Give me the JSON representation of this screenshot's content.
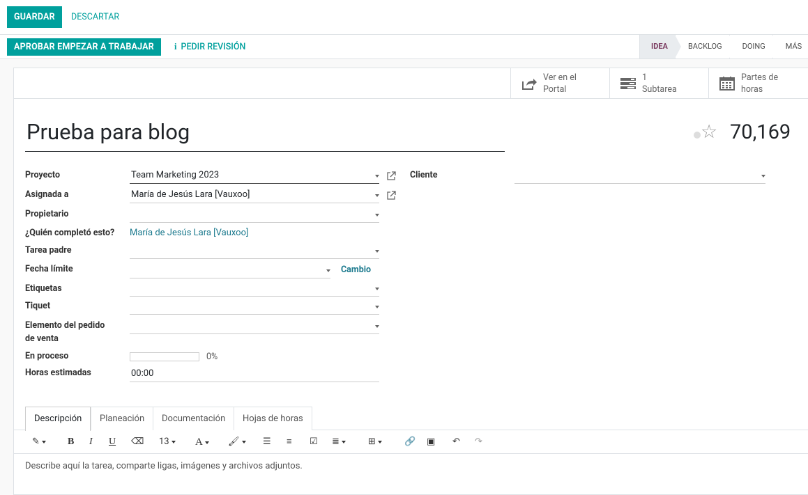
{
  "control_panel": {
    "save_label": "GUARDAR",
    "discard_label": "DESCARTAR"
  },
  "header": {
    "approve_label": "APROBAR EMPEZAR A TRABAJAR",
    "review_label": "PEDIR REVISIÓN",
    "stages": [
      {
        "label": "IDEA",
        "active": true
      },
      {
        "label": "BACKLOG",
        "active": false
      },
      {
        "label": "DOING",
        "active": false
      },
      {
        "label": "MÁS",
        "active": false
      }
    ]
  },
  "smart_buttons": [
    {
      "label": "Ver en el\nPortal",
      "line1": "Ver en el",
      "line2": "Portal",
      "icon": "share-icon"
    },
    {
      "label": "1\nSubtarea",
      "line1": "1",
      "line2": "Subtarea",
      "icon": "tasks-icon"
    },
    {
      "label": "Partes de\nhoras",
      "line1": "Partes de",
      "line2": "horas",
      "icon": "calendar-icon"
    }
  ],
  "task": {
    "title": "Prueba para blog",
    "priority_value": "70,169"
  },
  "fields": {
    "project_label": "Proyecto",
    "project_value": "Team Marketing 2023",
    "assigned_label": "Asignada a",
    "assigned_value": "María de Jesús Lara [Vauxoo]",
    "owner_label": "Propietario",
    "owner_value": "",
    "completed_by_label": "¿Quién completó esto?",
    "completed_by_value": "María de Jesús Lara [Vauxoo]",
    "parent_label": "Tarea padre",
    "parent_value": "",
    "deadline_label": "Fecha límite",
    "deadline_value": "",
    "deadline_change_label": "Cambio",
    "tags_label": "Etiquetas",
    "tags_value": "",
    "ticket_label": "Tiquet",
    "ticket_value": "",
    "sale_line_label_1": "Elemento del pedido",
    "sale_line_label_2": "de venta",
    "sale_line_value": "",
    "in_progress_label": "En proceso",
    "in_progress_percent": "0%",
    "in_progress_fraction": 0,
    "planned_hours_label": "Horas estimadas",
    "planned_hours_value": "00:00",
    "customer_label": "Cliente",
    "customer_value": ""
  },
  "tabs": [
    {
      "label": "Descripción",
      "active": true
    },
    {
      "label": "Planeación",
      "active": false
    },
    {
      "label": "Documentación",
      "active": false
    },
    {
      "label": "Hojas de horas",
      "active": false
    }
  ],
  "editor": {
    "font_size": "13",
    "placeholder": "Describe aquí la tarea, comparte ligas, imágenes y archivos adjuntos."
  },
  "colors": {
    "primary": "#00a09d",
    "link": "#1e7b8f",
    "active_stage_text": "#7c3d62"
  }
}
